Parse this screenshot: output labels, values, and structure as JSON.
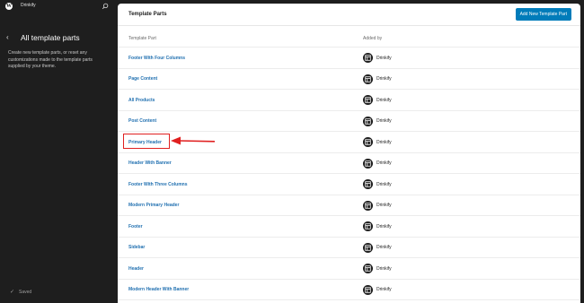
{
  "site": {
    "name": "Drinkify"
  },
  "sidebar": {
    "title": "All template parts",
    "description": "Create new template parts, or reset any customizations made to the template parts supplied by your theme.",
    "status": "Saved"
  },
  "main": {
    "title": "Template Parts",
    "add_button": "Add New Template Part",
    "columns": {
      "name": "Template Part",
      "added_by": "Added by"
    },
    "rows": [
      {
        "name": "Footer With Four Columns",
        "added_by": "Drinkify"
      },
      {
        "name": "Page Content",
        "added_by": "Drinkify"
      },
      {
        "name": "All Products",
        "added_by": "Drinkify"
      },
      {
        "name": "Post Content",
        "added_by": "Drinkify"
      },
      {
        "name": "Primary Header",
        "added_by": "Drinkify"
      },
      {
        "name": "Header With Banner",
        "added_by": "Drinkify"
      },
      {
        "name": "Footer With Three Columns",
        "added_by": "Drinkify"
      },
      {
        "name": "Modern Primary Header",
        "added_by": "Drinkify"
      },
      {
        "name": "Footer",
        "added_by": "Drinkify"
      },
      {
        "name": "Sidebar",
        "added_by": "Drinkify"
      },
      {
        "name": "Header",
        "added_by": "Drinkify"
      },
      {
        "name": "Modern Header With Banner",
        "added_by": "Drinkify"
      }
    ]
  },
  "icons": {
    "logo": "wordpress-icon",
    "search": "search-icon",
    "back": "chevron-left-icon",
    "saved": "check-icon",
    "theme": "layout-icon"
  },
  "colors": {
    "accent": "#007cba",
    "link": "#2271b1",
    "annotation": "#e02020",
    "sidebar_bg": "#1e1e1e"
  }
}
